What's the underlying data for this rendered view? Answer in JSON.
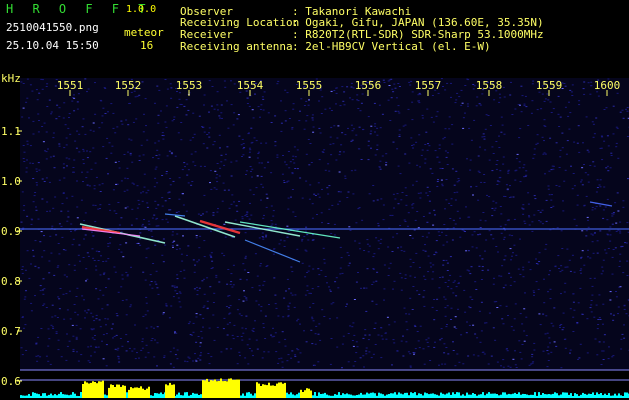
{
  "app": {
    "name": "H R O F F T",
    "version": "1.0.0"
  },
  "capture": {
    "filename": "2510041550.png",
    "datetime": "25.10.04 15:50",
    "meteor_label": "meteor",
    "meteor_count": "16"
  },
  "station": {
    "observer_label": "Observer",
    "observer_value": ": Takanori Kawachi",
    "location_label": "Receiving Location",
    "location_value": ": Ogaki, Gifu, JAPAN (136.60E, 35.35N)",
    "receiver_label": "Receiver",
    "receiver_value": ": R820T2(RTL-SDR) SDR-Sharp 53.1000MHz",
    "antenna_label": "Receiving antenna",
    "antenna_value": ": 2el-HB9CV Vertical (el. E-W)"
  },
  "axes": {
    "y_unit": "kHz",
    "x_ticks": [
      "1551",
      "1552",
      "1553",
      "1554",
      "1555",
      "1556",
      "1557",
      "1558",
      "1559",
      "1600"
    ],
    "y_ticks": [
      "1.1",
      "1.0",
      "0.9",
      "0.8",
      "0.7",
      "0.6"
    ]
  },
  "colors": {
    "background": "#000000",
    "noise": "#14147a",
    "carrier": "#4a6cff",
    "echo_hot": "#ff3a3a",
    "echo_warm": "#a0ffe0",
    "histogram_yellow": "#ffff00",
    "histogram_cyan": "#00ffff"
  }
}
